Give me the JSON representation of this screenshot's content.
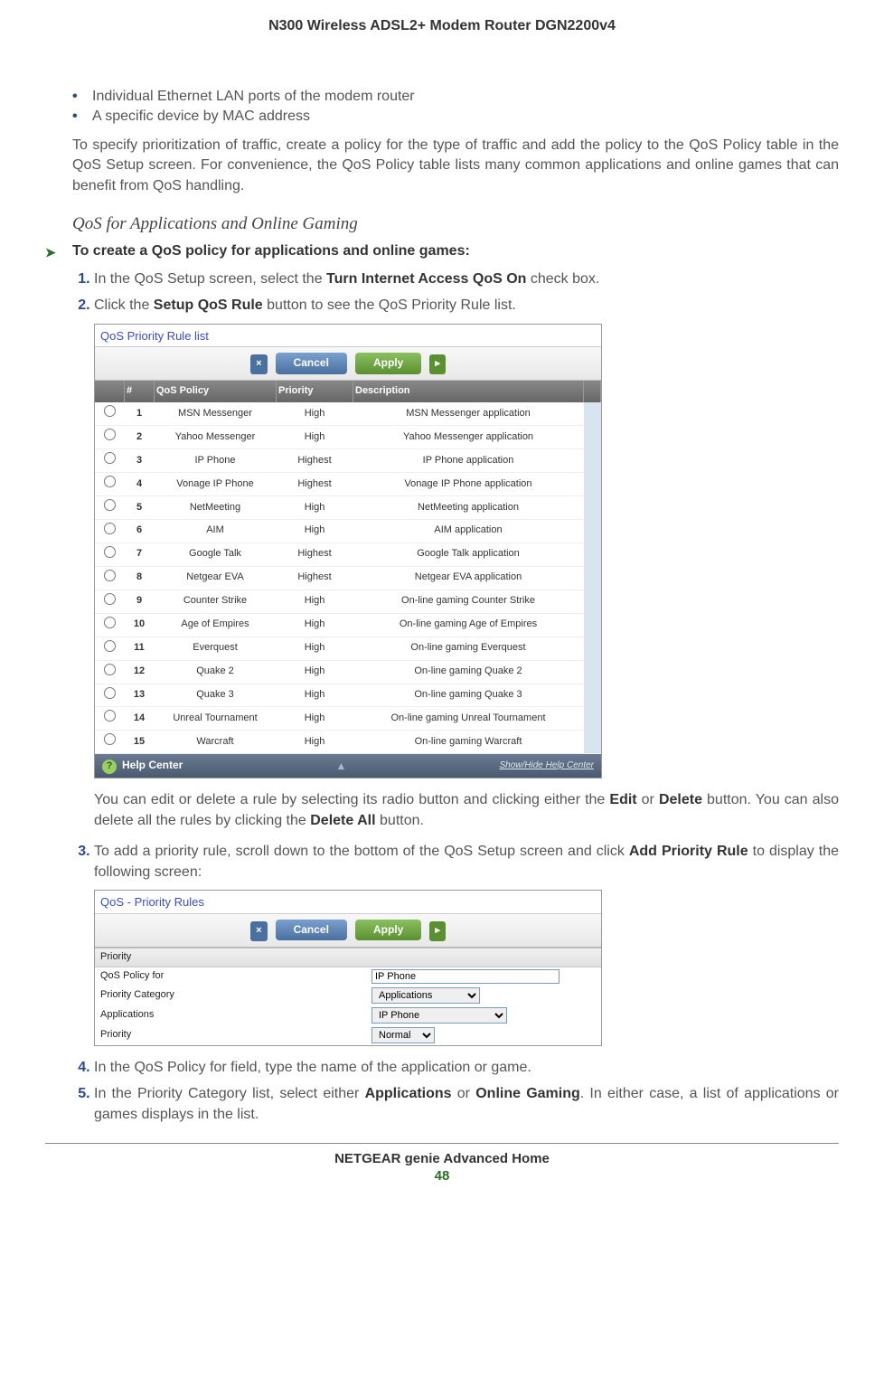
{
  "header": {
    "title": "N300 Wireless ADSL2+ Modem Router DGN2200v4"
  },
  "bullets": [
    "Individual Ethernet LAN ports of the modem router",
    "A specific device by MAC address"
  ],
  "intro_para": "To specify prioritization of traffic, create a policy for the type of traffic and add the policy to the QoS Policy table in the QoS Setup screen. For convenience, the QoS Policy table lists many common applications and online games that can benefit from QoS handling.",
  "subheading": "QoS for Applications and Online Gaming",
  "proc_heading": "To create a QoS policy for applications and online games:",
  "steps": {
    "s1_pre": "In the QoS Setup screen, select the ",
    "s1_bold": "Turn Internet Access QoS On",
    "s1_post": " check box.",
    "s2_pre": "Click the ",
    "s2_bold": "Setup QoS Rule",
    "s2_post": " button to see the QoS Priority Rule list.",
    "after2_p1_a": "You can edit or delete a rule by selecting its radio button and clicking either the ",
    "after2_b1": "Edit",
    "after2_mid": " or ",
    "after2_b2": "Delete",
    "after2_p1_b": " button. You can also delete all the rules by clicking the ",
    "after2_b3": "Delete All",
    "after2_p1_c": " button.",
    "s3_pre": "To add a priority rule, scroll down to the bottom of the QoS Setup screen and click ",
    "s3_bold": "Add Priority Rule",
    "s3_post": " to display the following screen:",
    "s4": "In the QoS Policy for field, type the name of the application or game.",
    "s5_pre": "In the Priority Category list, select either ",
    "s5_b1": "Applications",
    "s5_mid": " or ",
    "s5_b2": "Online Gaming",
    "s5_post": ". In either case, a list of applications or games displays in the list."
  },
  "screenshot1": {
    "title": "QoS Priority Rule list",
    "cancel": "Cancel",
    "apply": "Apply",
    "cols": {
      "num": "#",
      "policy": "QoS Policy",
      "priority": "Priority",
      "desc": "Description"
    },
    "rows": [
      {
        "n": "1",
        "p": "MSN Messenger",
        "pr": "High",
        "d": "MSN Messenger application"
      },
      {
        "n": "2",
        "p": "Yahoo Messenger",
        "pr": "High",
        "d": "Yahoo Messenger application"
      },
      {
        "n": "3",
        "p": "IP Phone",
        "pr": "Highest",
        "d": "IP Phone application"
      },
      {
        "n": "4",
        "p": "Vonage IP Phone",
        "pr": "Highest",
        "d": "Vonage IP Phone application"
      },
      {
        "n": "5",
        "p": "NetMeeting",
        "pr": "High",
        "d": "NetMeeting application"
      },
      {
        "n": "6",
        "p": "AIM",
        "pr": "High",
        "d": "AIM application"
      },
      {
        "n": "7",
        "p": "Google Talk",
        "pr": "Highest",
        "d": "Google Talk application"
      },
      {
        "n": "8",
        "p": "Netgear EVA",
        "pr": "Highest",
        "d": "Netgear EVA application"
      },
      {
        "n": "9",
        "p": "Counter Strike",
        "pr": "High",
        "d": "On-line gaming Counter Strike"
      },
      {
        "n": "10",
        "p": "Age of Empires",
        "pr": "High",
        "d": "On-line gaming Age of Empires"
      },
      {
        "n": "11",
        "p": "Everquest",
        "pr": "High",
        "d": "On-line gaming Everquest"
      },
      {
        "n": "12",
        "p": "Quake 2",
        "pr": "High",
        "d": "On-line gaming Quake 2"
      },
      {
        "n": "13",
        "p": "Quake 3",
        "pr": "High",
        "d": "On-line gaming Quake 3"
      },
      {
        "n": "14",
        "p": "Unreal Tournament",
        "pr": "High",
        "d": "On-line gaming Unreal Tournament"
      },
      {
        "n": "15",
        "p": "Warcraft",
        "pr": "High",
        "d": "On-line gaming Warcraft"
      }
    ],
    "help": "Help Center",
    "showhide": "Show/Hide Help Center"
  },
  "screenshot2": {
    "title": "QoS - Priority Rules",
    "cancel": "Cancel",
    "apply": "Apply",
    "section": "Priority",
    "rows": {
      "r1_label": "QoS Policy for",
      "r1_value": "IP Phone",
      "r2_label": "Priority Category",
      "r2_value": "Applications",
      "r3_label": "Applications",
      "r3_value": "IP Phone",
      "r4_label": "Priority",
      "r4_value": "Normal"
    }
  },
  "footer": {
    "text": "NETGEAR genie Advanced Home",
    "page": "48"
  }
}
